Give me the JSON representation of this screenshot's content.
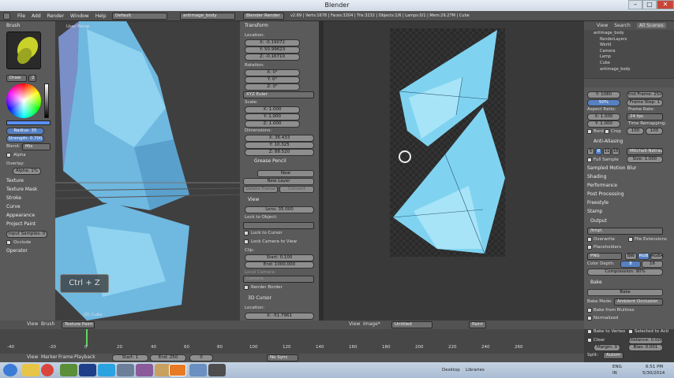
{
  "window": {
    "title": "Blender"
  },
  "menubar": {
    "items": [
      "File",
      "Add",
      "Render",
      "Window",
      "Help"
    ],
    "layout": "Default",
    "scene": "antimage_body",
    "engine": "Blender Render",
    "stats": "v2.69 | Verts:1678 | Faces:3204 | Tris:3232 | Objects:1/6 | Lamps:0/1 | Mem:29.27M | Cube"
  },
  "left_panel": {
    "brush_title": "Brush",
    "brush_name": "Draw",
    "brush_num": "2",
    "radius": "Radius: 35",
    "strength": "Strength: 0.700",
    "blend_label": "Blend:",
    "blend": "Mix",
    "alpha": "Alpha",
    "overlay": "Overlay:",
    "overlay_alpha": "Alpha: 1%",
    "sections": [
      "Texture",
      "Texture Mask",
      "Stroke",
      "Curve",
      "Appearance",
      "Project Paint"
    ],
    "input_samples": "Input Samples: 0",
    "occlude": "Occlude",
    "operator": "Operator"
  },
  "viewport": {
    "label": "User Persp",
    "shortcut": "Ctrl + Z",
    "cube": "(0) Cube"
  },
  "transform": {
    "title": "Transform",
    "location": "Location:",
    "loc": [
      "X: -0.19072",
      "Y: 50.99623",
      "Z: -0.16710"
    ],
    "rotation": "Rotation:",
    "rot": [
      "X: 0°",
      "Y: 0°",
      "Z: 0°"
    ],
    "euler": "XYZ Euler",
    "scale": "Scale:",
    "scl": [
      "X: 1.000",
      "Y: 1.000",
      "Z: 1.000"
    ],
    "dimensions": "Dimensions:",
    "dim": [
      "X: 36.433",
      "Y: 10.325",
      "Z: 88.520"
    ]
  },
  "grease": {
    "title": "Grease Pencil",
    "new": "New",
    "new_layer": "New Layer",
    "delete_frame": "Delete Frame",
    "convert": "Convert"
  },
  "view": {
    "title": "View",
    "lens": "Lens: 35.000",
    "lock_obj": "Lock to Object:",
    "lock_cursor": "Lock to Cursor",
    "lock_cam": "Lock Camera to View",
    "clip": "Clip:",
    "start": "Start: 0.100",
    "end": "End: 1000.000",
    "local_cam": "Local Camera:",
    "camera": "Camera",
    "render_border": "Render Border",
    "cursor3d": "3D Cursor",
    "location": "Location:",
    "cursor_x": "X: -51.7961"
  },
  "image_editor": {
    "view": "View",
    "image": "Image*",
    "name": "Untitled",
    "paint": "Paint"
  },
  "outliner": {
    "view": "View",
    "search": "Search",
    "all_scenes": "All Scenes",
    "items": [
      "antimage_body",
      "RenderLayers",
      "World",
      "Camera",
      "Lamp",
      "Cube",
      "antimage_body"
    ]
  },
  "properties": {
    "res_y": "Y: 1080",
    "pct": "50%",
    "end_frame": "End Frame: 250",
    "frame_step": "Frame Step: 1",
    "aspect": "Aspect Ratio:",
    "frame_rate": "Frame Rate:",
    "ax": "X: 1.000",
    "ay": "Y: 1.000",
    "fps": "24 fps",
    "time_remap": "Time Remapping:",
    "tr1": "100",
    "tr2": "100",
    "border": "Bord",
    "crop": "Crop",
    "aa": "Anti-Aliasing",
    "aa_samples": [
      "5",
      "8",
      "11",
      "16"
    ],
    "filter": "Mitchell-Netravali",
    "full_sample": "Full Sample",
    "size": "Size: 1.000",
    "sections": [
      "Sampled Motion Blur",
      "Shading",
      "Performance",
      "Post Processing",
      "Freestyle",
      "Stamp"
    ],
    "output": "Output",
    "path": "/tmp\\",
    "overwrite": "Overwrite",
    "file_ext": "File Extensions",
    "placeholders": "Placeholders",
    "format": "PNG",
    "bw": "BW",
    "rgb": "RGB",
    "rgba": "RGBA",
    "color_depth": "Color Depth:",
    "d8": "8",
    "d16": "16",
    "compression": "Compression: 90%",
    "bake": "Bake",
    "bake_btn": "Bake",
    "bake_mode_label": "Bake Mode:",
    "bake_mode": "Ambient Occlusion",
    "from_multires": "Bake from Multires",
    "normalized": "Normalized",
    "bake_to_vertex": "Bake to Vertex",
    "selected_active": "Selected to Acti",
    "clear": "Clear",
    "distance": "Distance: 0.000",
    "margin": "Margin: 3",
    "bias": "Bias: 0.001",
    "split": "Split:",
    "automatic": "Autom"
  },
  "viewport_header": {
    "view": "View",
    "brush": "Brush",
    "mode": "Texture Paint"
  },
  "timeline": {
    "ticks": [
      "-40",
      "-20",
      "0",
      "20",
      "40",
      "60",
      "80",
      "100",
      "120",
      "140",
      "160",
      "180",
      "200",
      "220",
      "240",
      "260"
    ],
    "view": "View",
    "marker": "Marker",
    "frame": "Frame",
    "playback": "Playback",
    "start": "Start: 1",
    "end": "End: 250",
    "current": "0",
    "sync": "No Sync"
  },
  "taskbar": {
    "desktop": "Desktop",
    "libraries": "Libraries",
    "lang": "ENG",
    "region": "IN",
    "time": "6:51 PM",
    "date": "5/30/2014"
  }
}
